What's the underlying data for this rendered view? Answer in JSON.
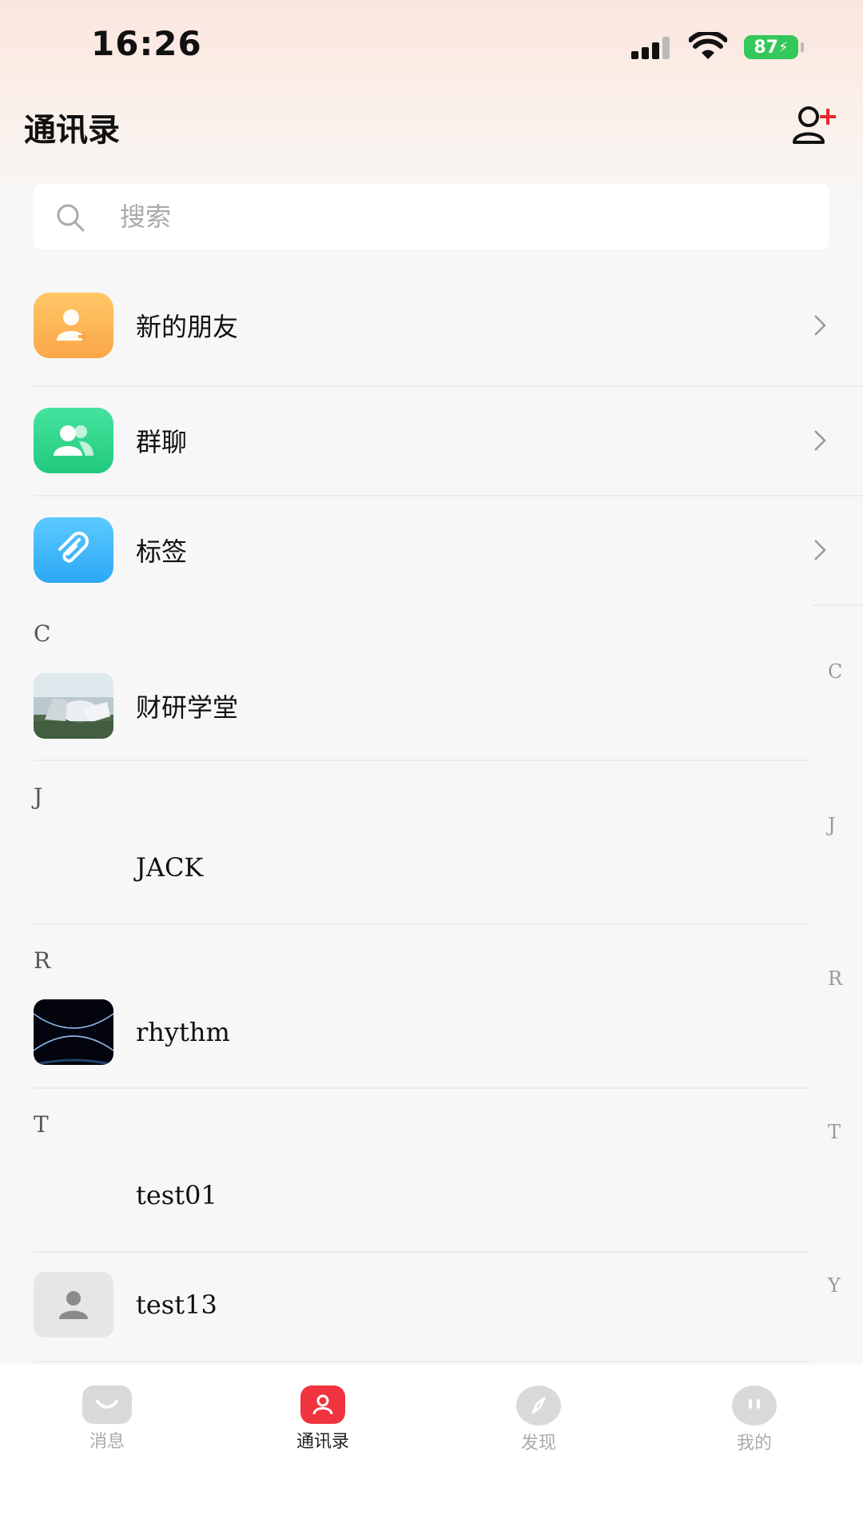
{
  "status_bar": {
    "time": "16:26",
    "battery": "87"
  },
  "header": {
    "title": "通讯录",
    "add_icon": "add-contact-icon"
  },
  "search": {
    "placeholder": "搜索"
  },
  "menu": [
    {
      "label": "新的朋友",
      "icon": "add-friend-icon",
      "color": "#fbb04d"
    },
    {
      "label": "群聊",
      "icon": "group-icon",
      "color": "#2fd58b"
    },
    {
      "label": "标签",
      "icon": "paperclip-icon",
      "color": "#3db6ff"
    }
  ],
  "sections": [
    {
      "letter": "C",
      "contacts": [
        {
          "name": "财研学堂",
          "avatar": "building-photo"
        }
      ]
    },
    {
      "letter": "J",
      "contacts": [
        {
          "name": "JACK",
          "avatar": "none"
        }
      ]
    },
    {
      "letter": "R",
      "contacts": [
        {
          "name": "rhythm",
          "avatar": "dark-abstract"
        }
      ]
    },
    {
      "letter": "T",
      "contacts": [
        {
          "name": "test01",
          "avatar": "none"
        },
        {
          "name": "test13",
          "avatar": "default-person"
        }
      ]
    }
  ],
  "index": [
    "C",
    "J",
    "R",
    "T",
    "Y"
  ],
  "tabs": [
    {
      "label": "消息",
      "icon": "message-icon",
      "active": false
    },
    {
      "label": "通讯录",
      "icon": "contacts-icon",
      "active": true
    },
    {
      "label": "发现",
      "icon": "compass-icon",
      "active": false
    },
    {
      "label": "我的",
      "icon": "profile-icon",
      "active": false
    }
  ],
  "colors": {
    "accent": "#f0343f",
    "background": "#f7f7f7"
  }
}
